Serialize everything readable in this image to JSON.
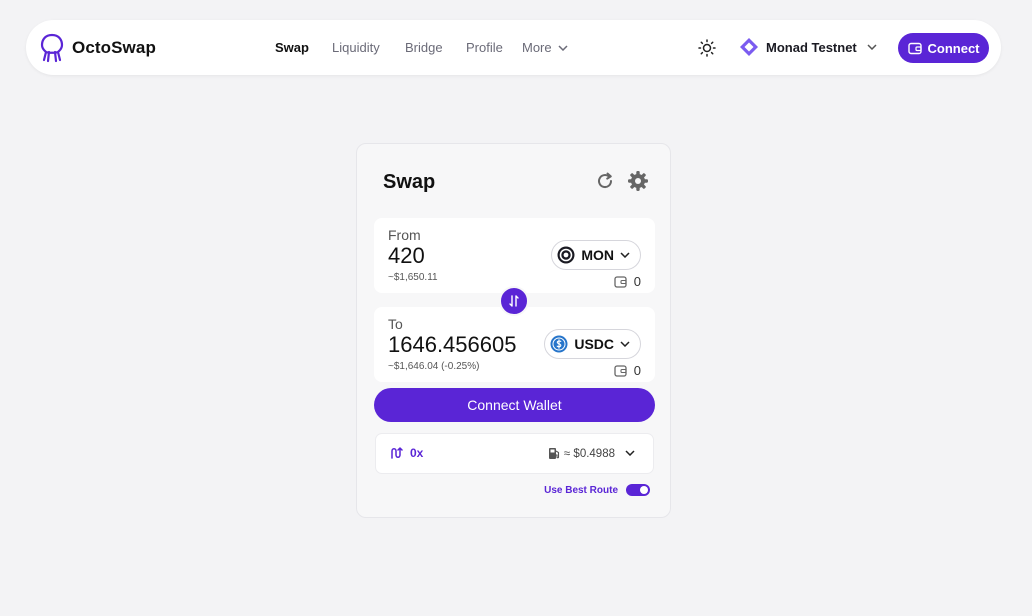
{
  "brand": {
    "name": "OctoSwap",
    "accent": "#5a25d6"
  },
  "nav": {
    "items": [
      {
        "label": "Swap",
        "active": true
      },
      {
        "label": "Liquidity",
        "active": false
      },
      {
        "label": "Bridge",
        "active": false
      },
      {
        "label": "Profile",
        "active": false
      }
    ],
    "more_label": "More"
  },
  "header": {
    "theme_icon": "sun-icon",
    "network_label": "Monad Testnet",
    "connect_label": "Connect"
  },
  "swap": {
    "title": "Swap",
    "from": {
      "label": "From",
      "amount": "420",
      "usd": "~$1,650.11",
      "token": "MON",
      "balance": "0"
    },
    "to": {
      "label": "To",
      "amount": "1646.456605",
      "usd": "~$1,646.04 (-0.25%)",
      "token": "USDC",
      "balance": "0"
    },
    "connect_wallet_label": "Connect Wallet",
    "route": {
      "provider": "0x",
      "fee": "≈ $0.4988"
    },
    "best_route_label": "Use Best Route",
    "best_route_enabled": true
  }
}
